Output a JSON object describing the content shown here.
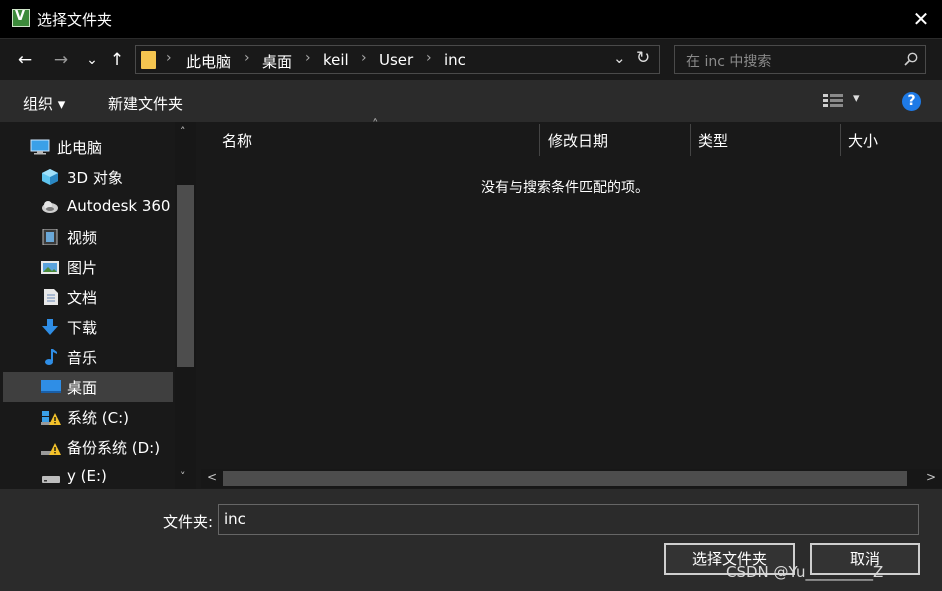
{
  "window": {
    "title": "选择文件夹",
    "close_glyph": "✕"
  },
  "nav": {
    "back_glyph": "←",
    "forward_glyph": "→",
    "recent_glyph": "⌄",
    "up_glyph": "↑",
    "breadcrumbs": [
      "此电脑",
      "桌面",
      "keil",
      "User",
      "inc"
    ],
    "separator": "›",
    "address_chevron": "⌄",
    "refresh_glyph": "↻",
    "search_placeholder": "在 inc 中搜索"
  },
  "toolbar": {
    "organize_label": "组织 ▾",
    "new_folder_label": "新建文件夹",
    "view_chevron": "▾",
    "help_glyph": "?"
  },
  "sidebar": {
    "items": [
      {
        "label": "此电脑",
        "icon": "computer-icon"
      },
      {
        "label": "3D 对象",
        "icon": "3d-objects-icon"
      },
      {
        "label": "Autodesk 360",
        "icon": "autodesk-cloud-icon"
      },
      {
        "label": "视频",
        "icon": "video-icon"
      },
      {
        "label": "图片",
        "icon": "pictures-icon"
      },
      {
        "label": "文档",
        "icon": "documents-icon"
      },
      {
        "label": "下载",
        "icon": "download-icon"
      },
      {
        "label": "音乐",
        "icon": "music-icon"
      },
      {
        "label": "桌面",
        "icon": "desktop-icon",
        "selected": true
      },
      {
        "label": "系统 (C:)",
        "icon": "drive-warning-icon"
      },
      {
        "label": "备份系统 (D:)",
        "icon": "drive-warning-icon"
      },
      {
        "label": "y (E:)",
        "icon": "drive-icon"
      }
    ],
    "scroll_up_glyph": "˄",
    "scroll_down_glyph": "˅"
  },
  "filelist": {
    "columns": [
      "名称",
      "修改日期",
      "类型",
      "大小"
    ],
    "sort_caret": "˄",
    "empty_message": "没有与搜索条件匹配的项。",
    "scroll_left_glyph": "<",
    "scroll_right_glyph": ">"
  },
  "footer": {
    "folder_label": "文件夹:",
    "folder_value": "inc",
    "select_button": "选择文件夹",
    "cancel_button": "取消",
    "watermark": "CSDN @Yu_________Z"
  },
  "colors": {
    "background": "#191919",
    "toolbar": "#2b2b2b",
    "selection": "#3f3f3f",
    "folder_yellow": "#f4c550",
    "help_blue": "#1e7ae6"
  }
}
